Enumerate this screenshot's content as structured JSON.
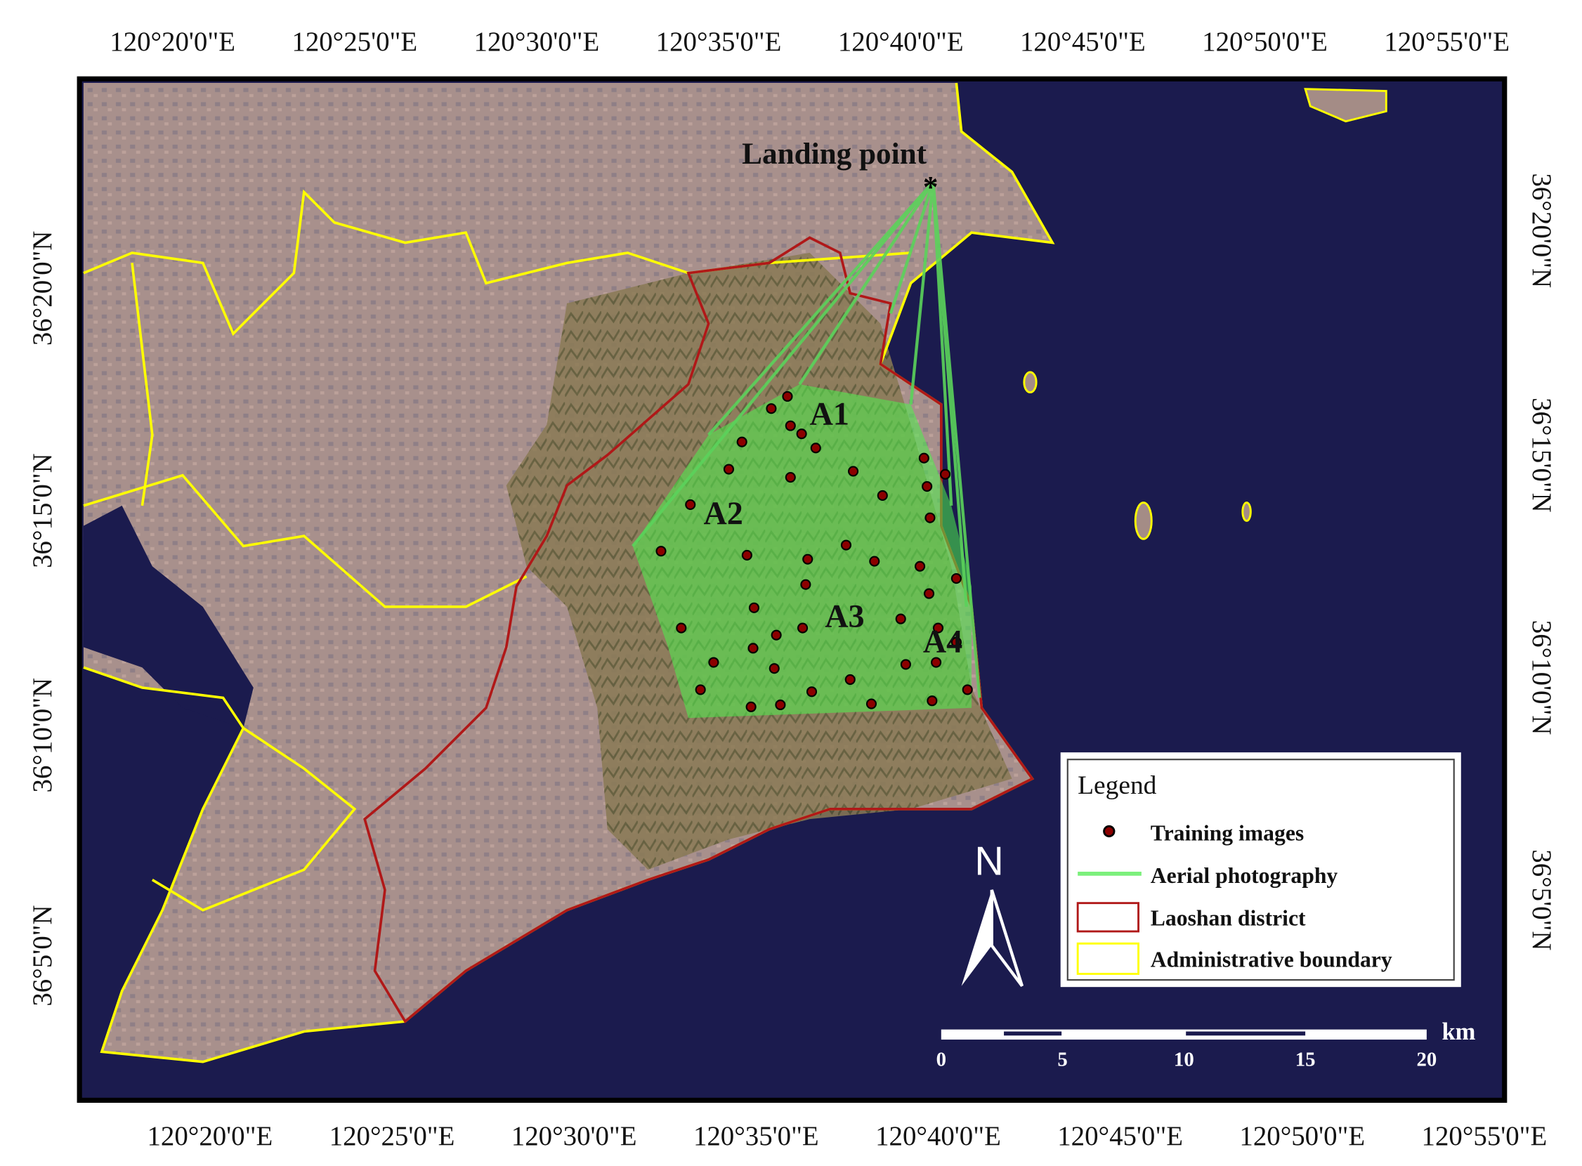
{
  "map": {
    "top_lon_labels": [
      "120°20'0\"E",
      "120°25'0\"E",
      "120°30'0\"E",
      "120°35'0\"E",
      "120°40'0\"E",
      "120°45'0\"E",
      "120°50'0\"E",
      "120°55'0\"E"
    ],
    "bottom_lon_labels": [
      "120°20'0\"E",
      "120°25'0\"E",
      "120°30'0\"E",
      "120°35'0\"E",
      "120°40'0\"E",
      "120°45'0\"E",
      "120°50'0\"E",
      "120°55'0\"E"
    ],
    "left_lat_labels": [
      "36°20'0\"N",
      "36°15'0\"N",
      "36°10'0\"N",
      "36°5'0\"N"
    ],
    "right_lat_labels": [
      "36°20'0\"N",
      "36°15'0\"N",
      "36°10'0\"N",
      "36°5'0\"N"
    ],
    "landing_point_label": "Landing point",
    "area_labels": [
      "A1",
      "A2",
      "A3",
      "A4"
    ],
    "north_label": "N",
    "scale_bar": {
      "unit": "km",
      "ticks": [
        "0",
        "5",
        "10",
        "15",
        "20"
      ]
    },
    "legend": {
      "title": "Legend",
      "items": [
        "Training images",
        "Aerial photography",
        "Laoshan district",
        "Administrative boundary"
      ]
    },
    "colors": {
      "sea": "#1b1b4e",
      "land": "#a48c86",
      "aerial": "#7cf07c",
      "laoshan": "#b01818",
      "admin": "#ffff00",
      "points": "#8b0000"
    }
  }
}
